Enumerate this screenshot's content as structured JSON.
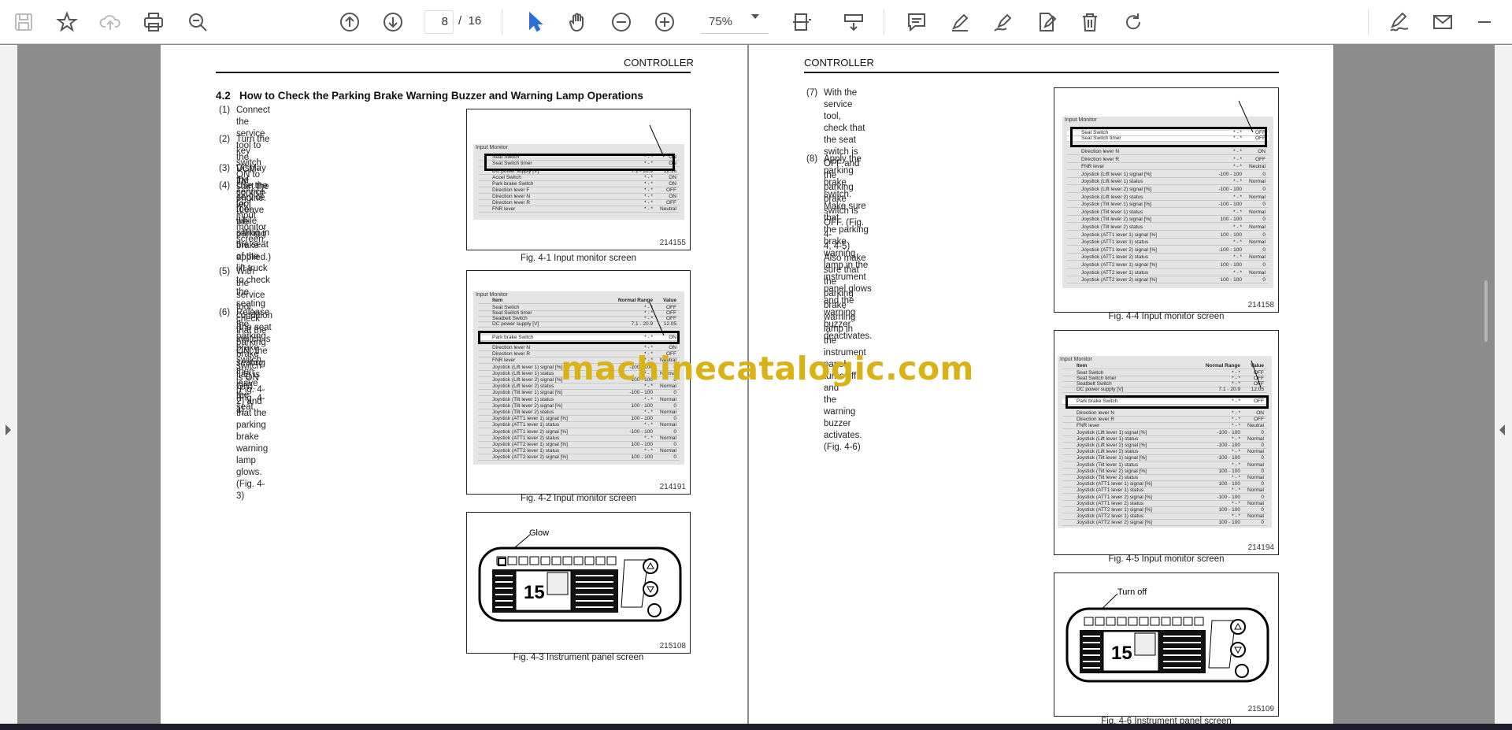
{
  "toolbar": {
    "current_page": "8",
    "page_separator": "/",
    "total_pages": "16",
    "zoom": "75%",
    "icons": [
      "save-icon",
      "bookmark-star-icon",
      "cloud-upload-icon",
      "print-icon",
      "zoom-search-icon",
      "page-up-icon",
      "page-down-icon",
      "select-cursor-icon",
      "hand-pan-icon",
      "zoom-out-icon",
      "zoom-in-icon",
      "fit-page-icon",
      "scroll-mode-icon",
      "comment-icon",
      "highlight-pen-icon",
      "draw-pen-icon",
      "edit-page-icon",
      "delete-icon",
      "rotate-icon",
      "sign-icon",
      "email-icon"
    ]
  },
  "left_page": {
    "header": "CONTROLLER",
    "section_number": "4.2",
    "section_title": "How to Check the Parking Brake Warning Buzzer and Warning Lamp Operations",
    "steps": [
      {
        "num": "(1)",
        "lines": [
          "Connect the service tool to the VCM-1M control-",
          "ler."
        ]
      },
      {
        "num": "(2)",
        "lines": [
          "Turn the key switch ON to start the engine.",
          "(Leave the parking brake applied.)"
        ]
      },
      {
        "num": "(3)",
        "lines": [
          "Display the service tool input monitor screen."
        ]
      },
      {
        "num": "(4)",
        "lines": [
          "Use the service tool while sitting in the seat of the",
          "lift truck to check the seating condition (the seat",
          "switch is ON, the seating flag is ON). (Fig. 4-1)"
        ]
      },
      {
        "num": "(5)",
        "lines": [
          "With the service tool, check that the parking brake",
          "switch is ON (Fig. 4-2) and that the parking brake",
          "warning lamp glows. (Fig. 4-3)"
        ]
      },
      {
        "num": "(6)",
        "lines": [
          "Release the parking brake switch, then leave the",
          "seat."
        ]
      }
    ],
    "figures": [
      {
        "number": "214155",
        "caption": "Fig. 4-1 Input monitor screen"
      },
      {
        "number": "214191",
        "caption": "Fig. 4-2 Input monitor screen"
      },
      {
        "number": "215108",
        "caption": "Fig. 4-3 Instrument panel screen",
        "callout": "Glow"
      }
    ]
  },
  "right_page": {
    "header": "CONTROLLER",
    "steps": [
      {
        "num": "(7)",
        "lines": [
          "With the service tool, check that the seat switch is",
          "OFF and the parking brake switch is OFF. (Fig. 4-",
          "4, 4-5) Also make sure that the parking brake",
          "warning lamp in the instrument panel turns off and",
          "the warning buzzer activates. (Fig. 4-6)"
        ]
      },
      {
        "num": "(8)",
        "lines": [
          "Apply the parking brake switch. Make sure that",
          "the parking brake warning lamp in the instrument",
          "panel glows and the warning buzzer deactivates."
        ]
      }
    ],
    "figures": [
      {
        "number": "214158",
        "caption": "Fig. 4-4 Input monitor screen"
      },
      {
        "number": "214194",
        "caption": "Fig. 4-5 Input monitor screen"
      },
      {
        "number": "215109",
        "caption": "Fig. 4-6 Instrument panel screen",
        "callout": "Turn off"
      }
    ]
  },
  "monitor": {
    "title": "Input Monitor",
    "col_item": "Item",
    "col_range": "Normal Range",
    "col_value": "Value",
    "rows_fig1": [
      {
        "name": "Seat Switch",
        "range": "* - *",
        "value": "ON"
      },
      {
        "name": "Seat Switch timer",
        "range": "* - *",
        "value": "ON"
      },
      {
        "name": "DC power supply [V]",
        "range": "7.1 - 20.9",
        "value": "12.16"
      },
      {
        "name": "Accel Switch",
        "range": "* - *",
        "value": "ON"
      },
      {
        "name": "Park brake Switch",
        "range": "* - *",
        "value": "ON"
      },
      {
        "name": "Direction lever F",
        "range": "* - *",
        "value": "OFF"
      },
      {
        "name": "Direction lever N",
        "range": "* - *",
        "value": "ON"
      },
      {
        "name": "Direction lever R",
        "range": "* - *",
        "value": "OFF"
      },
      {
        "name": "FNR lever",
        "range": "* - *",
        "value": "Neutral"
      }
    ],
    "rows_fig2_top": [
      {
        "name": "Seat Switch",
        "range": "* - *",
        "value": "OFF"
      },
      {
        "name": "Seat Switch timer",
        "range": "* - *",
        "value": "OFF"
      },
      {
        "name": "Seatbelt Switch",
        "range": "* - *",
        "value": "OFF"
      },
      {
        "name": "DC power supply [V]",
        "range": "7.1 - 20.9",
        "value": "12.05"
      }
    ],
    "highlight_park": {
      "name": "Park brake Switch",
      "range": "* - *",
      "value": "ON"
    },
    "highlight_park_off": {
      "name": "Park brake Switch",
      "range": "* - *",
      "value": "OFF"
    },
    "highlight_seat": [
      {
        "name": "Seat Switch",
        "range": "* - *",
        "value": "OFF"
      },
      {
        "name": "Seat Switch timer",
        "range": "* - *",
        "value": "OFF"
      }
    ],
    "rows_long": [
      {
        "name": "Direction lever N",
        "range": "* - *",
        "value": "ON"
      },
      {
        "name": "Direction lever R",
        "range": "* - *",
        "value": "OFF"
      },
      {
        "name": "FNR lever",
        "range": "* - *",
        "value": "Neutral"
      },
      {
        "name": "Joystick (Lift lever 1) signal [%]",
        "range": "-100 - 100",
        "value": "0"
      },
      {
        "name": "Joystick (Lift lever 1) status",
        "range": "* - *",
        "value": "Normal"
      },
      {
        "name": "Joystick (Lift lever 2) signal [%]",
        "range": "-100 - 100",
        "value": "0"
      },
      {
        "name": "Joystick (Lift lever 2) status",
        "range": "* - *",
        "value": "Normal"
      },
      {
        "name": "Joystick (Tilt lever 1) signal [%]",
        "range": "-100 - 100",
        "value": "0"
      },
      {
        "name": "Joystick (Tilt lever 1) status",
        "range": "* - *",
        "value": "Normal"
      },
      {
        "name": "Joystick (Tilt lever 2) signal [%]",
        "range": "100 - 100",
        "value": "0"
      },
      {
        "name": "Joystick (Tilt lever 2) status",
        "range": "* - *",
        "value": "Normal"
      },
      {
        "name": "Joystick (ATT1 lever 1) signal [%]",
        "range": "100 - 100",
        "value": "0"
      },
      {
        "name": "Joystick (ATT1 lever 1) status",
        "range": "* - *",
        "value": "Normal"
      },
      {
        "name": "Joystick (ATT1 lever 2) signal [%]",
        "range": "-100 - 100",
        "value": "0"
      },
      {
        "name": "Joystick (ATT1 lever 2) status",
        "range": "* - *",
        "value": "Normal"
      },
      {
        "name": "Joystick (ATT2 lever 1) signal [%]",
        "range": "100 - 100",
        "value": "0"
      },
      {
        "name": "Joystick (ATT2 lever 1) status",
        "range": "* - *",
        "value": "Normal"
      },
      {
        "name": "Joystick (ATT2 lever 2) signal [%]",
        "range": "100 - 100",
        "value": "0"
      }
    ]
  },
  "panel_speed": "15",
  "watermark": "machinecatalogic.com"
}
